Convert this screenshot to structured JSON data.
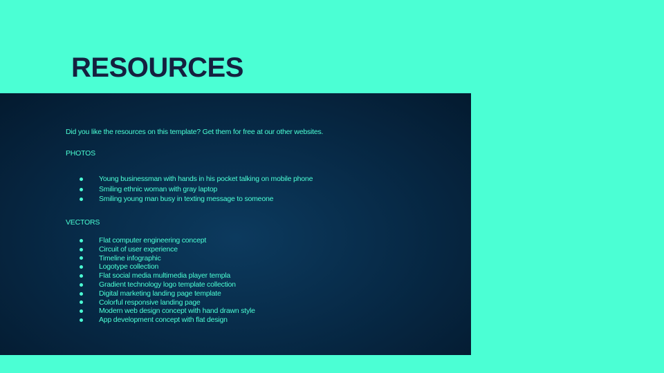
{
  "title": "RESOURCES",
  "intro": "Did you like the resources on this template? Get them for free at our other websites.",
  "photos": {
    "heading": "PHOTOS",
    "items": [
      "Young businessman with hands in his pocket talking on mobile phone",
      "Smiling ethnic woman with gray laptop",
      "Smiling young man busy in texting message to someone"
    ]
  },
  "vectors": {
    "heading": "VECTORS",
    "items": [
      "Flat computer engineering concept",
      "Circuit of user experience",
      "Timeline infographic",
      "Logotype collection",
      "Flat social media multimedia player templa",
      "Gradient technology logo template collection",
      "Digital marketing landing page template",
      "Colorful responsive landing page",
      "Modern web design concept with hand drawn style",
      "App development concept with flat design"
    ]
  },
  "colors": {
    "background": "#4bffd4",
    "title": "#15203f",
    "panel": "#072a47",
    "text": "#4bffd4"
  }
}
